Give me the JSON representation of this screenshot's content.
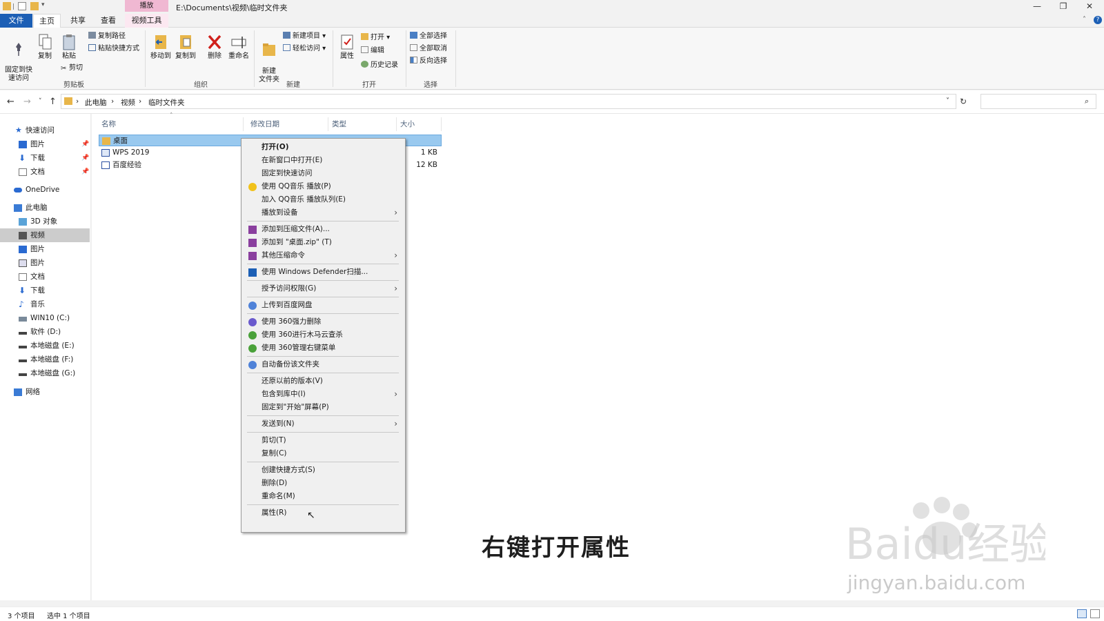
{
  "window": {
    "path": "E:\\Documents\\视频\\临时文件夹",
    "context_tab_group": "播放",
    "controls": [
      "—",
      "❐",
      "✕"
    ]
  },
  "tabs": [
    "文件",
    "主页",
    "共享",
    "查看",
    "视频工具"
  ],
  "ribbon": {
    "clipboard": {
      "pin": "固定到快\n速访问",
      "copy": "复制",
      "paste": "粘贴",
      "copy_path": "复制路径",
      "paste_shortcut": "粘贴快捷方式",
      "cut": "剪切",
      "group": "剪贴板"
    },
    "organize": {
      "move_to": "移动到",
      "copy_to": "复制到",
      "delete": "删除",
      "rename": "重命名",
      "group": "组织"
    },
    "new": {
      "new_folder": "新建\n文件夹",
      "new_item": "新建项目",
      "easy_access": "轻松访问",
      "group": "新建"
    },
    "open": {
      "properties": "属性",
      "open": "打开",
      "edit": "编辑",
      "history": "历史记录",
      "group": "打开"
    },
    "select": {
      "select_all": "全部选择",
      "select_none": "全部取消",
      "invert": "反向选择",
      "group": "选择"
    }
  },
  "address": {
    "crumbs": [
      "此电脑",
      "视频",
      "临时文件夹"
    ]
  },
  "navpane": [
    {
      "label": "快速访问",
      "icon": "star-icon",
      "pinned": false
    },
    {
      "label": "图片",
      "icon": "pictures-icon",
      "pinned": true
    },
    {
      "label": "下载",
      "icon": "download-icon",
      "pinned": true
    },
    {
      "label": "文档",
      "icon": "document-icon",
      "pinned": true
    },
    {
      "label": "OneDrive",
      "icon": "cloud-icon",
      "pinned": false
    },
    {
      "label": "此电脑",
      "icon": "computer-icon",
      "pinned": false
    },
    {
      "label": "3D 对象",
      "icon": "cube-icon",
      "pinned": false
    },
    {
      "label": "视频",
      "icon": "video-icon",
      "pinned": false
    },
    {
      "label": "图片",
      "icon": "pictures-icon",
      "pinned": false
    },
    {
      "label": "图片",
      "icon": "image-icon",
      "pinned": false
    },
    {
      "label": "文档",
      "icon": "document-icon",
      "pinned": false
    },
    {
      "label": "下载",
      "icon": "download-icon",
      "pinned": false
    },
    {
      "label": "音乐",
      "icon": "music-icon",
      "pinned": false
    },
    {
      "label": "WIN10 (C:)",
      "icon": "system-drive-icon",
      "pinned": false
    },
    {
      "label": "软件 (D:)",
      "icon": "drive-icon",
      "pinned": false
    },
    {
      "label": "本地磁盘 (E:)",
      "icon": "drive-icon",
      "pinned": false
    },
    {
      "label": "本地磁盘 (F:)",
      "icon": "drive-icon",
      "pinned": false
    },
    {
      "label": "本地磁盘 (G:)",
      "icon": "drive-icon",
      "pinned": false
    },
    {
      "label": "网络",
      "icon": "network-icon",
      "pinned": false
    }
  ],
  "columns": [
    "名称",
    "修改日期",
    "类型",
    "大小"
  ],
  "files": [
    {
      "name": "桌面",
      "size": "",
      "icon": "folder-icon"
    },
    {
      "name": "WPS 2019",
      "size": "1 KB",
      "icon": "shortcut-icon"
    },
    {
      "name": "百度经验",
      "size": "12 KB",
      "icon": "word-doc-icon"
    }
  ],
  "context_menu": [
    {
      "label": "打开(O)",
      "icon": "",
      "submenu": false,
      "bold": true
    },
    {
      "label": "在新窗口中打开(E)",
      "icon": "",
      "submenu": false
    },
    {
      "label": "固定到快速访问",
      "icon": "",
      "submenu": false
    },
    {
      "label": "使用 QQ音乐 播放(P)",
      "icon": "qqmusic-icon",
      "submenu": false
    },
    {
      "label": "加入 QQ音乐 播放队列(E)",
      "icon": "",
      "submenu": false
    },
    {
      "label": "播放到设备",
      "icon": "",
      "submenu": true
    },
    {
      "sep": true
    },
    {
      "label": "添加到压缩文件(A)...",
      "icon": "archive-icon",
      "submenu": false
    },
    {
      "label": "添加到 \"桌面.zip\" (T)",
      "icon": "archive-icon",
      "submenu": false
    },
    {
      "label": "其他压缩命令",
      "icon": "archive-icon",
      "submenu": true
    },
    {
      "sep": true
    },
    {
      "label": "使用 Windows Defender扫描...",
      "icon": "defender-shield-icon",
      "submenu": false
    },
    {
      "sep": true
    },
    {
      "label": "授予访问权限(G)",
      "icon": "",
      "submenu": true
    },
    {
      "sep": true
    },
    {
      "label": "上传到百度网盘",
      "icon": "baidu-cloud-icon",
      "submenu": false
    },
    {
      "sep": true
    },
    {
      "label": "使用 360强力删除",
      "icon": "360-delete-icon",
      "submenu": false
    },
    {
      "label": "使用 360进行木马云查杀",
      "icon": "360-scan-icon",
      "submenu": false
    },
    {
      "label": "使用 360管理右键菜单",
      "icon": "360-menu-icon",
      "submenu": false
    },
    {
      "sep": true
    },
    {
      "label": "自动备份该文件夹",
      "icon": "baidu-cloud-icon",
      "submenu": false
    },
    {
      "sep": true
    },
    {
      "label": "还原以前的版本(V)",
      "icon": "",
      "submenu": false
    },
    {
      "label": "包含到库中(I)",
      "icon": "",
      "submenu": true
    },
    {
      "label": "固定到\"开始\"屏幕(P)",
      "icon": "",
      "submenu": false
    },
    {
      "sep": true
    },
    {
      "label": "发送到(N)",
      "icon": "",
      "submenu": true
    },
    {
      "sep": true
    },
    {
      "label": "剪切(T)",
      "icon": "",
      "submenu": false
    },
    {
      "label": "复制(C)",
      "icon": "",
      "submenu": false
    },
    {
      "sep": true
    },
    {
      "label": "创建快捷方式(S)",
      "icon": "",
      "submenu": false
    },
    {
      "label": "删除(D)",
      "icon": "",
      "submenu": false
    },
    {
      "label": "重命名(M)",
      "icon": "",
      "submenu": false
    },
    {
      "sep": true
    },
    {
      "label": "属性(R)",
      "icon": "",
      "submenu": false
    }
  ],
  "status": {
    "count": "3 个项目",
    "selected": "选中 1 个项目"
  },
  "caption": "右键打开属性",
  "watermark": {
    "logo": "Baidu经验",
    "url": "jingyan.baidu.com"
  },
  "colors": {
    "file_tab": "#1c5fb5",
    "context_tab": "#f0b8d2",
    "selection": "#99c9ef",
    "nav_selected": "#cccccc"
  }
}
